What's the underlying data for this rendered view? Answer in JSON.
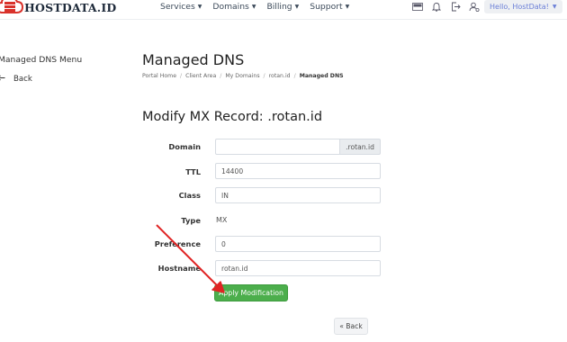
{
  "brand": {
    "name": "HOSTDATA.ID"
  },
  "nav": {
    "items": [
      {
        "label": "Services"
      },
      {
        "label": "Domains"
      },
      {
        "label": "Billing"
      },
      {
        "label": "Support"
      }
    ],
    "tools": [
      {
        "icon": "language-flag-icon"
      },
      {
        "icon": "bell-icon"
      },
      {
        "icon": "logout-icon"
      },
      {
        "icon": "user-settings-icon"
      }
    ],
    "greeting": "Hello, HostData!"
  },
  "sidebar": {
    "title": "Managed DNS Menu",
    "back_label": "Back"
  },
  "page": {
    "title": "Managed DNS",
    "breadcrumb": [
      "Portal Home",
      "Client Area",
      "My Domains",
      "rotan.id",
      "Managed DNS"
    ]
  },
  "form": {
    "title": "Modify MX Record: .rotan.id",
    "domain": {
      "label": "Domain",
      "value": "",
      "suffix": ".rotan.id"
    },
    "ttl": {
      "label": "TTL",
      "value": "14400"
    },
    "class": {
      "label": "Class",
      "value": "IN"
    },
    "type": {
      "label": "Type",
      "value": "MX"
    },
    "preference": {
      "label": "Preference",
      "value": "0"
    },
    "hostname": {
      "label": "Hostname",
      "value": "rotan.id"
    },
    "apply_label": "Apply Modification",
    "back_label": "« Back"
  },
  "colors": {
    "primary_green": "#4cae4c",
    "annotation_arrow": "#e02424",
    "logo_red": "#d9322b",
    "greeting_text": "#6b7fd7"
  }
}
